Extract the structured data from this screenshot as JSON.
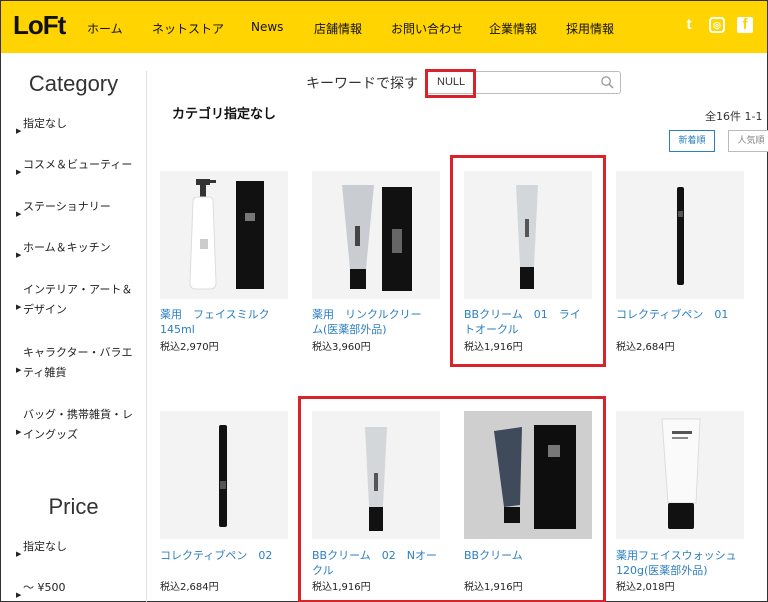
{
  "header": {
    "logo": "LoFt",
    "nav": [
      "ホーム",
      "ネットストア",
      "News",
      "店舗情報",
      "お問い合わせ",
      "企業情報",
      "採用情報"
    ],
    "social_icons": [
      "twitter-icon",
      "instagram-icon",
      "facebook-icon"
    ],
    "social_glyphs": [
      "t",
      "◎",
      "f"
    ],
    "background": "#ffd400"
  },
  "sidebar": {
    "category_heading": "Category",
    "categories": [
      "指定なし",
      "コスメ＆ビューティー",
      "ステーショナリー",
      "ホーム＆キッチン",
      "インテリア・アート＆デザイン",
      "キャラクター・バラエティ雑貨",
      "バッグ・携帯雑貨・レイングッズ"
    ],
    "price_heading": "Price",
    "prices": [
      "指定なし",
      "～ ¥500"
    ]
  },
  "search": {
    "label": "キーワードで探す",
    "value": "NULL"
  },
  "main": {
    "title": "カテゴリ指定なし",
    "count": "全16件 1-1",
    "sort_new": "新着順",
    "sort_popular": "人気順"
  },
  "products": [
    {
      "name": "薬用　フェイスミルク　145ml",
      "price": "税込2,970円"
    },
    {
      "name": "薬用　リンクルクリーム(医薬部外品)",
      "price": "税込3,960円"
    },
    {
      "name": "BBクリーム　01　ライトオークル",
      "price": "税込1,916円"
    },
    {
      "name": "コレクティブペン　01",
      "price": "税込2,684円"
    },
    {
      "name": "コレクティブペン　02",
      "price": "税込2,684円"
    },
    {
      "name": "BBクリーム　02　Nオークル",
      "price": "税込1,916円"
    },
    {
      "name": "BBクリーム",
      "price": "税込1,916円"
    },
    {
      "name": "薬用フェイスウォッシュ 120g(医薬部外品)",
      "price": "税込2,018円"
    }
  ],
  "colors": {
    "accent": "#ffd400",
    "link": "#2b7fc1",
    "highlight": "#d9232a"
  }
}
